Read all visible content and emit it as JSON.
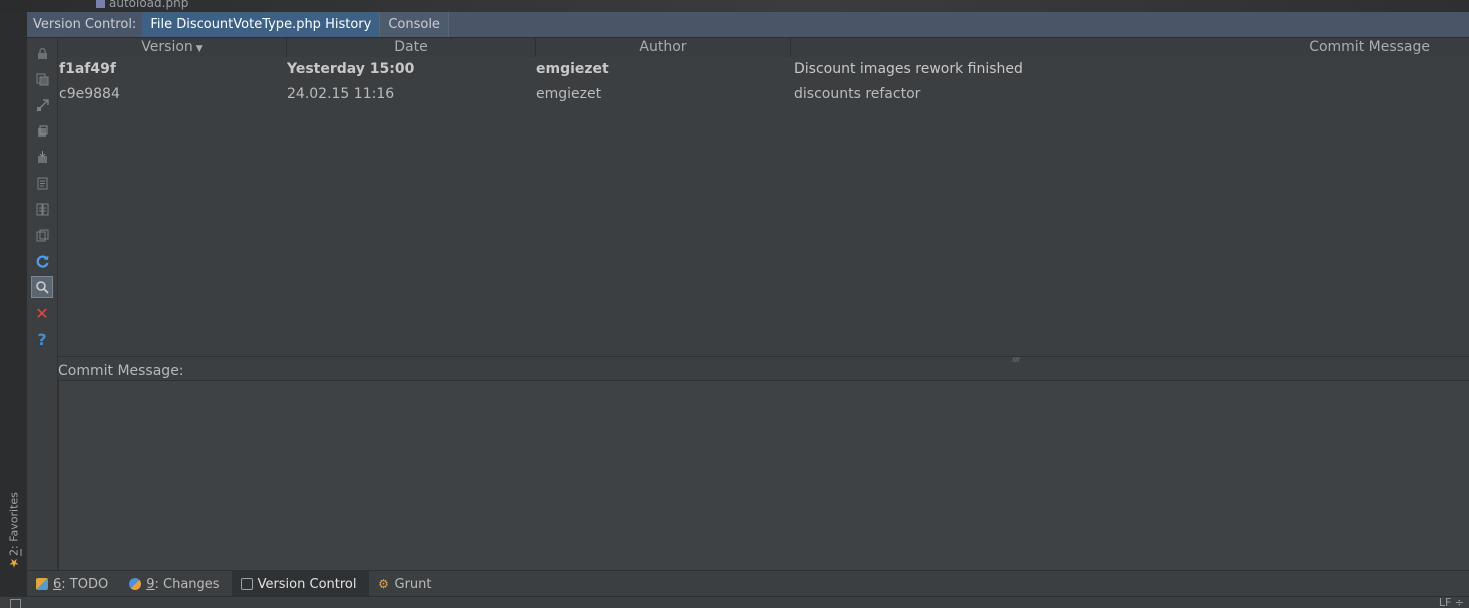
{
  "editor_remnant": {
    "file_name": "autoload.php"
  },
  "tool_window": {
    "prefix": "Version Control:",
    "tabs": [
      {
        "label": "File DiscountVoteType.php History",
        "active": true
      },
      {
        "label": "Console",
        "active": false
      }
    ]
  },
  "left_toolbar": {
    "icons": [
      "lock-icon",
      "copy-icon",
      "diff-icon",
      "copy-revision-icon",
      "get-revision-icon",
      "annotate-icon",
      "compare-icon",
      "clipboard-icon",
      "refresh-icon",
      "search-icon",
      "close-icon",
      "help-icon"
    ]
  },
  "history_table": {
    "columns": [
      "Version",
      "Date",
      "Author",
      "Commit Message"
    ],
    "sort_column": "Version",
    "rows": [
      {
        "version": "f1af49f",
        "date": "Yesterday 15:00",
        "author": "emgiezet",
        "message": "Discount images rework finished",
        "bold": true
      },
      {
        "version": "c9e9884",
        "date": "24.02.15 11:16",
        "author": "emgiezet",
        "message": "discounts refactor",
        "bold": false
      }
    ]
  },
  "commit_message": {
    "label": "Commit Message:",
    "value": ""
  },
  "favorites": {
    "number": "2",
    "label": ": Favorites"
  },
  "bottom_tabs": [
    {
      "number": "6",
      "label": ": TODO",
      "icon": "todo-icon",
      "active": false
    },
    {
      "number": "9",
      "label": ": Changes",
      "icon": "changes-icon",
      "active": false
    },
    {
      "number": "",
      "label": "Version Control",
      "icon": "version-control-icon",
      "active": true
    },
    {
      "number": "",
      "label": "Grunt",
      "icon": "grunt-icon",
      "active": false
    }
  ],
  "status_bar": {
    "line_separator": "LF ÷"
  },
  "colors": {
    "header_bg": "#4a5668",
    "active_tab_bg": "#3d6185",
    "panel_bg": "#3c3f41",
    "refresh_blue": "#4e9ee8",
    "close_red": "#e2493a",
    "star_orange": "#e8a633"
  }
}
